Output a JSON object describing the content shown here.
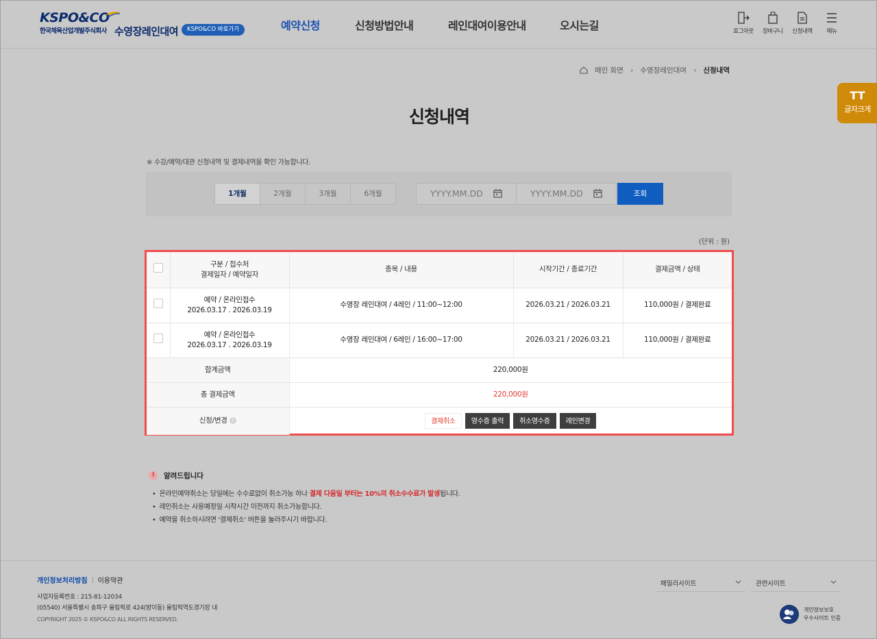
{
  "header": {
    "logo_main": "KSPO&CO",
    "logo_sub": "한국체육산업개발주식회사",
    "site_name": "수영장레인대여",
    "kspo_link": "KSPO&CO 바로가기",
    "nav": [
      "예약신청",
      "신청방법안내",
      "레인대여이용안내",
      "오시는길"
    ],
    "utils": [
      "로그아웃",
      "장바구니",
      "신청내역",
      "메뉴"
    ]
  },
  "breadcrumb": {
    "home": "메인 화면",
    "mid": "수영장레인대여",
    "current": "신청내역"
  },
  "font_size_btn": {
    "icon": "TT",
    "label": "글자크게"
  },
  "page_title": "신청내역",
  "notice_top": "※ 수강/예약/대관 신청내역 및 결제내역을 확인 가능합니다.",
  "search": {
    "periods": [
      "1개월",
      "2개월",
      "3개월",
      "6개월"
    ],
    "active_period": "1개월",
    "start_placeholder": "YYYY.MM.DD",
    "end_placeholder": "YYYY.MM.DD",
    "submit": "조회"
  },
  "unit": "(단위 : 원)",
  "table": {
    "headers": {
      "type_1": "구분 / 접수처",
      "type_2": "결제일자 / 예약일자",
      "item": "종목 / 내용",
      "period": "시작기간 / 종료기간",
      "amount": "결제금액 / 상태"
    },
    "rows": [
      {
        "type": "예약 / 온라인접수",
        "dates": "2026.03.17 . 2026.03.19",
        "item": "수영장 레인대여 / 4레인 / 11:00~12:00",
        "period": "2026.03.21 /  2026.03.21",
        "amount": "110,000원 / 결제완료"
      },
      {
        "type": "예약 / 온라인접수",
        "dates": "2026.03.17 . 2026.03.19",
        "item": "수영장 레인대여 / 6레인 / 16:00~17:00",
        "period": "2026.03.21 /  2026.03.21",
        "amount": "110,000원 / 결제완료"
      }
    ],
    "sum_label": "합계금액",
    "sum_value": "220,000원",
    "total_label": "총 결제금액",
    "total_value": "220,000원",
    "action_label": "신청/변경",
    "help": "?",
    "actions": {
      "cancel": "결제취소",
      "receipt": "영수증 출력",
      "cancel_receipt": "취소영수증",
      "lane_change": "레인변경"
    }
  },
  "notice": {
    "title": "알려드립니다",
    "line1_pre": "온라인예약취소는 당일에는 수수료없이 취소가능 하나 ",
    "line1_hl": "결제 다음일 부터는 10%의 취소수수료가 발생",
    "line1_post": "됩니다.",
    "line2": "레인취소는 사용예정일 시작시간 이전까지 취소가능합니다.",
    "line3": "예약을 취소하시려면 '결제취소' 버튼을 눌러주시기 바랍니다."
  },
  "footer": {
    "privacy": "개인정보처리방침",
    "terms": "이용약관",
    "biz_no": "사업자등록번호 : 215-81-12034",
    "address": "(05540) 서울특별시 송파구 올림픽로 424(방이동) 올림픽역도경기장 내",
    "copyright": "COPYRIGHT 2025 © KSPO&CO ALL RIGHTS RESERVED.",
    "family_site": "패밀리사이트",
    "related_site": "관련사이트",
    "cert_line1": "개인정보보호",
    "cert_line2": "우수사이트 인증"
  },
  "colors": {
    "brand_blue": "#0e5dbf",
    "highlight_border": "#f24b4b",
    "accent_orange": "#d08a09",
    "alert_red": "#e23b2b"
  }
}
